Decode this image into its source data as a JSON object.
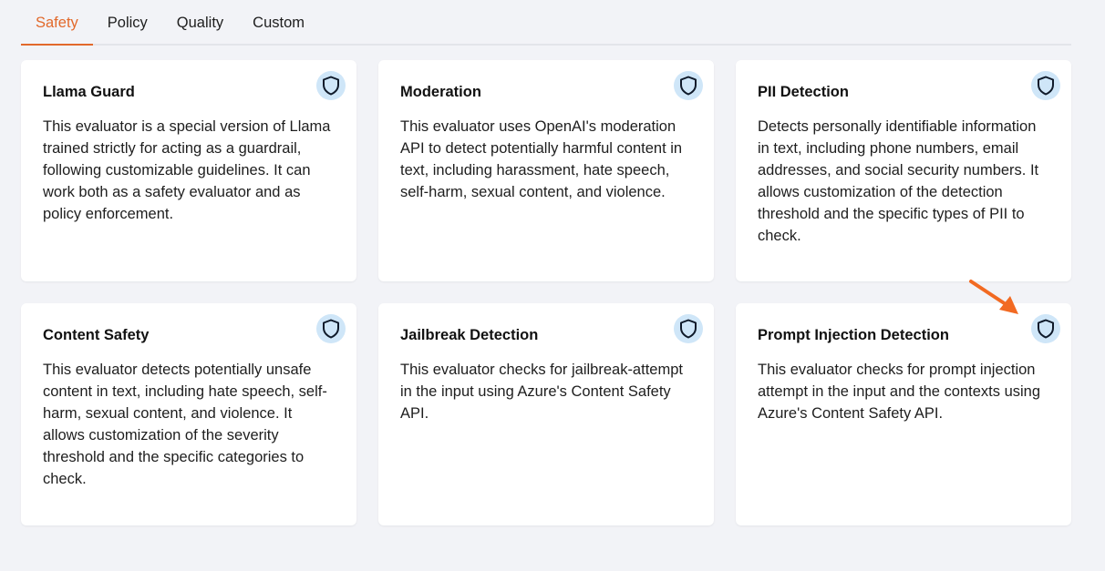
{
  "tabs": [
    {
      "label": "Safety",
      "active": true
    },
    {
      "label": "Policy",
      "active": false
    },
    {
      "label": "Quality",
      "active": false
    },
    {
      "label": "Custom",
      "active": false
    }
  ],
  "cards": [
    {
      "title": "Llama Guard",
      "description": "This evaluator is a special version of Llama trained strictly for acting as a guardrail, following customizable guidelines. It can work both as a safety evaluator and as policy enforcement.",
      "icon": "shield-icon"
    },
    {
      "title": "Moderation",
      "description": "This evaluator uses OpenAI's moderation API to detect potentially harmful content in text, including harassment, hate speech, self-harm, sexual content, and violence.",
      "icon": "shield-icon"
    },
    {
      "title": "PII Detection",
      "description": "Detects personally identifiable information in text, including phone numbers, email addresses, and social security numbers. It allows customization of the detection threshold and the specific types of PII to check.",
      "icon": "shield-icon"
    },
    {
      "title": "Content Safety",
      "description": "This evaluator detects potentially unsafe content in text, including hate speech, self-harm, sexual content, and violence. It allows customization of the severity threshold and the specific categories to check.",
      "icon": "shield-icon"
    },
    {
      "title": "Jailbreak Detection",
      "description": "This evaluator checks for jailbreak-attempt in the input using Azure's Content Safety API.",
      "icon": "shield-icon"
    },
    {
      "title": "Prompt Injection Detection",
      "description": "This evaluator checks for prompt injection attempt in the input and the contexts using Azure's Content Safety API.",
      "icon": "shield-icon"
    }
  ],
  "colors": {
    "accent": "#e2692b",
    "icon_bg": "#cfe6f8",
    "icon_stroke": "#0f1a2a",
    "annotation_arrow": "#f26a22"
  }
}
